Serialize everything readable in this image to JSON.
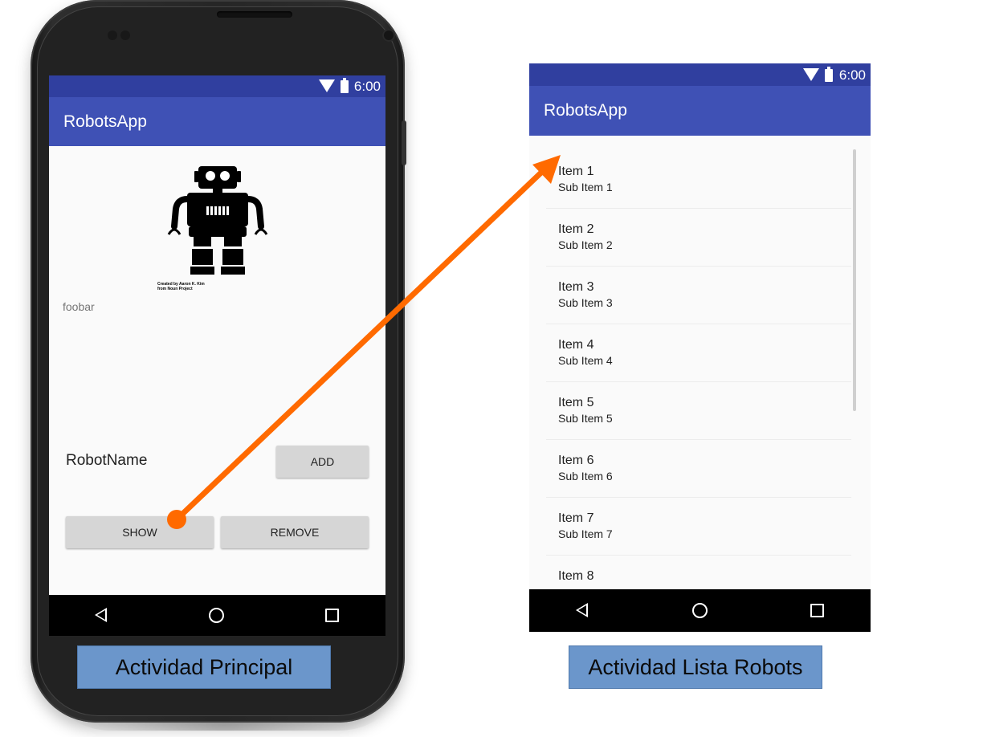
{
  "colors": {
    "primary": "#3f51b5",
    "primary_dark": "#303f9f",
    "accent_arrow": "#ff6a00",
    "caption_bg": "#6b96cb"
  },
  "status_bar": {
    "time": "6:00",
    "icons": [
      "wifi-icon",
      "battery-icon"
    ]
  },
  "main_activity": {
    "app_title": "RobotsApp",
    "robot_image_credit": "Created by Aaron K. Kim\nfrom Noun Project",
    "foobar_text": "foobar",
    "robot_name_label": "RobotName",
    "add_button": "ADD",
    "show_button": "SHOW",
    "remove_button": "REMOVE",
    "caption": "Actividad Principal"
  },
  "list_activity": {
    "app_title": "RobotsApp",
    "items": [
      {
        "title": "Item 1",
        "subtitle": "Sub Item 1"
      },
      {
        "title": "Item 2",
        "subtitle": "Sub Item 2"
      },
      {
        "title": "Item 3",
        "subtitle": "Sub Item 3"
      },
      {
        "title": "Item 4",
        "subtitle": "Sub Item 4"
      },
      {
        "title": "Item 5",
        "subtitle": "Sub Item 5"
      },
      {
        "title": "Item 6",
        "subtitle": "Sub Item 6"
      },
      {
        "title": "Item 7",
        "subtitle": "Sub Item 7"
      },
      {
        "title": "Item 8",
        "subtitle": ""
      }
    ],
    "caption": "Actividad Lista Robots"
  },
  "nav_bar": {
    "icons": [
      "back-icon",
      "home-icon",
      "recents-icon"
    ]
  }
}
